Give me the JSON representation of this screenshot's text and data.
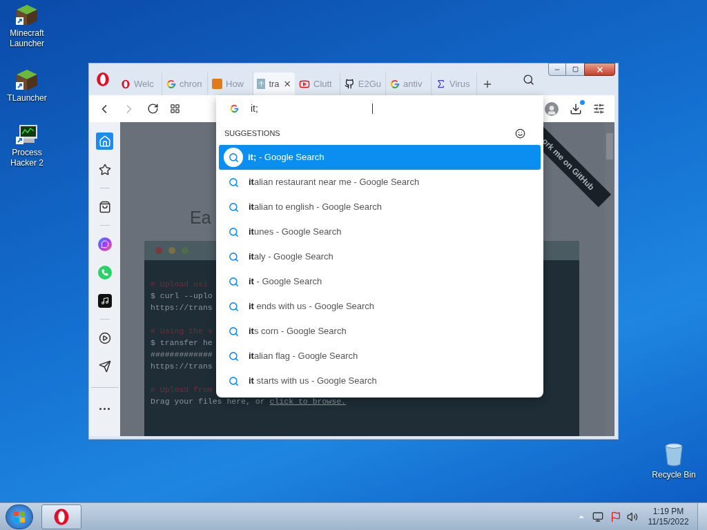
{
  "desktop_icons": [
    {
      "label": "Minecraft Launcher",
      "kind": "grass"
    },
    {
      "label": "TLauncher",
      "kind": "grass"
    },
    {
      "label": "Process Hacker 2",
      "kind": "monitor"
    }
  ],
  "recycle_bin": {
    "label": "Recycle Bin"
  },
  "browser": {
    "tabs": [
      {
        "title": "Welc",
        "kind": "opera",
        "selected": false
      },
      {
        "title": "chron",
        "kind": "google",
        "selected": false
      },
      {
        "title": "How",
        "kind": "mc",
        "selected": false
      },
      {
        "title": "tra",
        "kind": "upload",
        "selected": true
      },
      {
        "title": "Clutt",
        "kind": "youtube",
        "selected": false
      },
      {
        "title": "E2Gu",
        "kind": "github",
        "selected": false
      },
      {
        "title": "antiv",
        "kind": "google",
        "selected": false
      },
      {
        "title": "Virus",
        "kind": "sigma",
        "selected": false
      }
    ],
    "sidebar": [
      {
        "kind": "home",
        "selected": true
      },
      {
        "kind": "star",
        "selected": false
      },
      {
        "kind": "bag",
        "selected": false
      },
      {
        "kind": "messenger",
        "selected": false
      },
      {
        "kind": "whatsapp",
        "selected": false
      },
      {
        "kind": "tiktok",
        "selected": false
      },
      {
        "kind": "play",
        "selected": false
      },
      {
        "kind": "send",
        "selected": false
      },
      {
        "kind": "more",
        "selected": false
      }
    ],
    "address": {
      "value": "it;"
    },
    "suggestions_heading": "SUGGESTIONS",
    "suggestions": [
      {
        "text": "**it;** - Google Search",
        "selected": true
      },
      {
        "text": "**it**alian restaurant near me - Google Search",
        "selected": false
      },
      {
        "text": "**it**alian to english - Google Search",
        "selected": false
      },
      {
        "text": "**it**unes - Google Search",
        "selected": false
      },
      {
        "text": "**it**aly - Google Search",
        "selected": false
      },
      {
        "text": "**it** - Google Search",
        "selected": false
      },
      {
        "text": "**it** ends with us - Google Search",
        "selected": false
      },
      {
        "text": "**it**s corn - Google Search",
        "selected": false
      },
      {
        "text": "**it**alian flag - Google Search",
        "selected": false
      },
      {
        "text": "**it** starts with us - Google Search",
        "selected": false
      }
    ],
    "page": {
      "heading": "Ea",
      "ribbon": "ork me on GitHub",
      "code_lines": [
        {
          "text": "# Upload usi",
          "kind": "comment"
        },
        {
          "text": "$ curl --uplo",
          "kind": "command"
        },
        {
          "text": "https://trans",
          "kind": "output"
        },
        {
          "text": "# Using the s",
          "kind": "comment"
        },
        {
          "text": "$ transfer he",
          "kind": "command"
        },
        {
          "text": "#############",
          "kind": "output"
        },
        {
          "text": "https://trans",
          "kind": "output"
        },
        {
          "text": "# Upload from",
          "kind": "comment"
        }
      ],
      "drop_text": "Drag your files here, or",
      "drop_link": "click to browse."
    }
  },
  "taskbar": {
    "time": "1:19 PM",
    "date": "11/15/2022"
  }
}
